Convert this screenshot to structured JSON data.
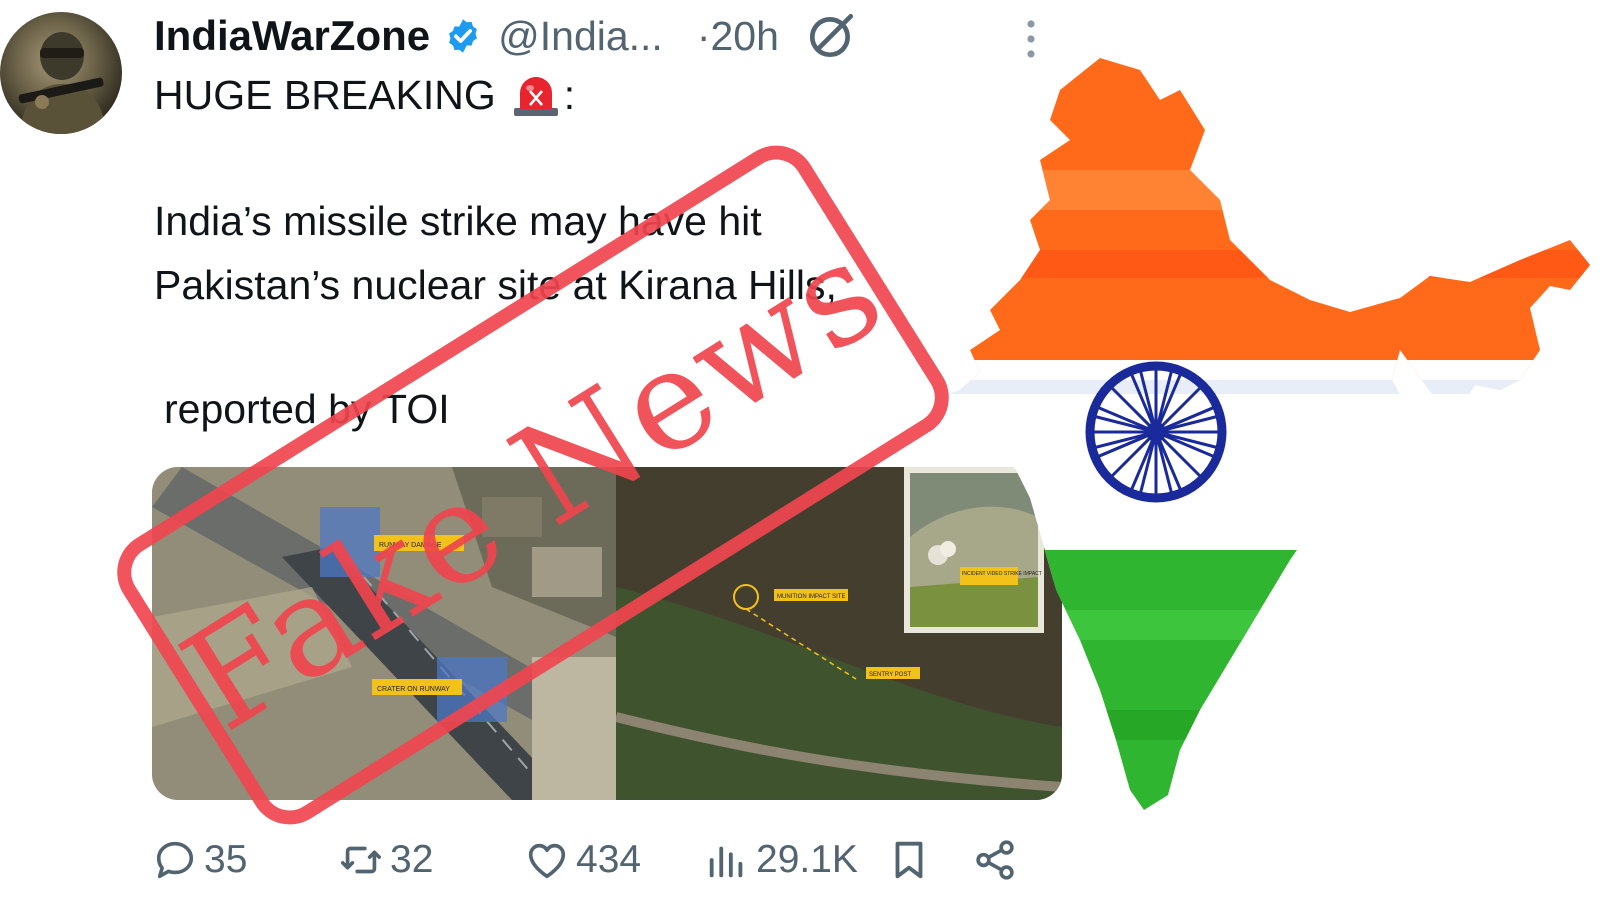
{
  "tweet": {
    "author": {
      "display_name": "IndiaWarZone",
      "handle": "@India...",
      "time": "·20h",
      "avatar_icon": "soldier-avatar",
      "verified_icon": "verified-badge-icon"
    },
    "lines": [
      "HUGE BREAKING",
      "India’s missile strike may have hit",
      "Pakistan’s nuclear site at Kirana Hills,",
      "reported by TOI"
    ],
    "heading_suffix": ":",
    "emoji_icon": "siren-icon",
    "media": {
      "left_labels": [
        "RUNWAY DAMAGE",
        "CRATER ON RUNWAY"
      ],
      "right_labels": [
        "MUNITION IMPACT SITE",
        "SENTRY POST",
        "INCIDENT VIDEO STRIKE IMPACT"
      ]
    },
    "actions": {
      "replies": "35",
      "reposts": "32",
      "likes": "434",
      "views": "29.1K"
    }
  },
  "overlay": {
    "stamp_text": "Fake News",
    "stamp_color": "#f0454e",
    "flag_colors": {
      "saffron": "#ff6a1a",
      "white": "#ffffff",
      "green": "#2fb52f",
      "chakra": "#1a2a9a"
    }
  },
  "colors": {
    "text_primary": "#0f1419",
    "text_secondary": "#536471",
    "verified_blue": "#1d9bf0"
  }
}
